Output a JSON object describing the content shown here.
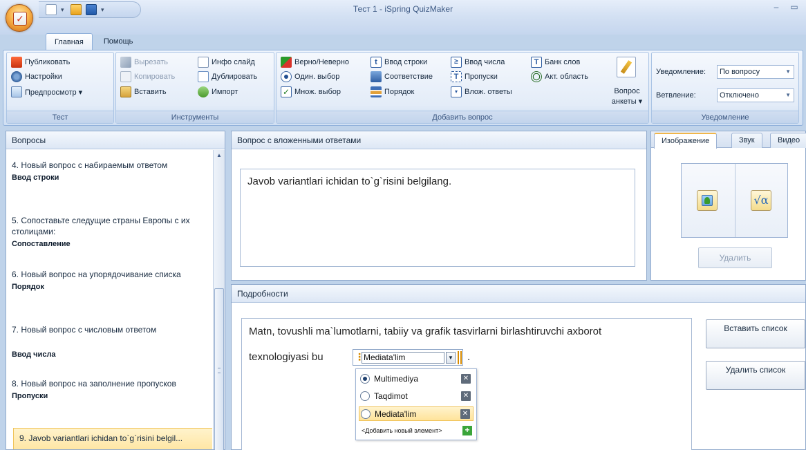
{
  "window": {
    "title": "Тест 1 - iSpring QuizMaker",
    "minimize": "–",
    "maximize": "▭"
  },
  "quick_access": {
    "dropdown": "▾"
  },
  "ribbon": {
    "tabs": [
      {
        "label": "Главная",
        "active": true
      },
      {
        "label": "Помощь",
        "active": false
      }
    ],
    "groups": {
      "test": {
        "label": "Тест",
        "buttons": [
          "Публиковать",
          "Настройки",
          "Предпросмотр ▾"
        ]
      },
      "tools": {
        "label": "Инструменты",
        "buttons": [
          "Вырезать",
          "Копировать",
          "Вставить",
          "Инфо слайд",
          "Дублировать",
          "Импорт"
        ]
      },
      "add_question": {
        "label": "Добавить вопрос",
        "buttons": [
          "Верно/Неверно",
          "Один. выбор",
          "Множ. выбор",
          "Ввод строки",
          "Соответствие",
          "Порядок",
          "Ввод числа",
          "Пропуски",
          "Влож. ответы",
          "Банк слов",
          "Акт. область"
        ],
        "survey_label_1": "Вопрос",
        "survey_label_2": "анкеты ▾"
      },
      "notification": {
        "label": "Уведомление",
        "notify_label": "Уведомление:",
        "notify_value": "По вопросу",
        "branch_label": "Ветвление:",
        "branch_value": "Отключено"
      }
    }
  },
  "questions_panel": {
    "title": "Вопросы",
    "items": [
      {
        "text": "4. Новый вопрос с набираемым ответом",
        "type": "Ввод строки"
      },
      {
        "text": "5. Сопоставьте следущие страны Европы с их столицами:",
        "type": "Сопоставление"
      },
      {
        "text": "6. Новый вопрос на упорядочивание списка",
        "type": "Порядок"
      },
      {
        "text": "7. Новый вопрос с числовым ответом",
        "type": "Ввод числа"
      },
      {
        "text": "8. Новый вопрос на заполнение пропусков",
        "type": "Пропуски"
      },
      {
        "text": "9. Javob variantlari ichidan to`g`risini belgil...",
        "type": ""
      }
    ]
  },
  "question_panel": {
    "title": "Вопрос с вложенными ответами",
    "text": "Javob variantlari ichidan to`g`risini belgilang."
  },
  "media_panel": {
    "tabs": [
      "Изображение",
      "Звук",
      "Видео"
    ],
    "formula_symbol": "√α",
    "delete_label": "Удалить"
  },
  "details_panel": {
    "title": "Подробности",
    "line1": "Matn, tovushli ma`lumotlarni, tabiiy va grafik tasvirlarni birlashtiruvchi axborot",
    "line2": "texnologiyasi bu",
    "blank_value": "Mediata'lim",
    "period": ".",
    "options": [
      {
        "label": "Multimediya",
        "selected": true
      },
      {
        "label": "Taqdimot",
        "selected": false
      },
      {
        "label": "Mediata'lim",
        "selected": false
      }
    ],
    "add_option_label": "<Добавить новый элемент>",
    "insert_list_label": "Вставить список",
    "delete_list_label": "Удалить список"
  }
}
